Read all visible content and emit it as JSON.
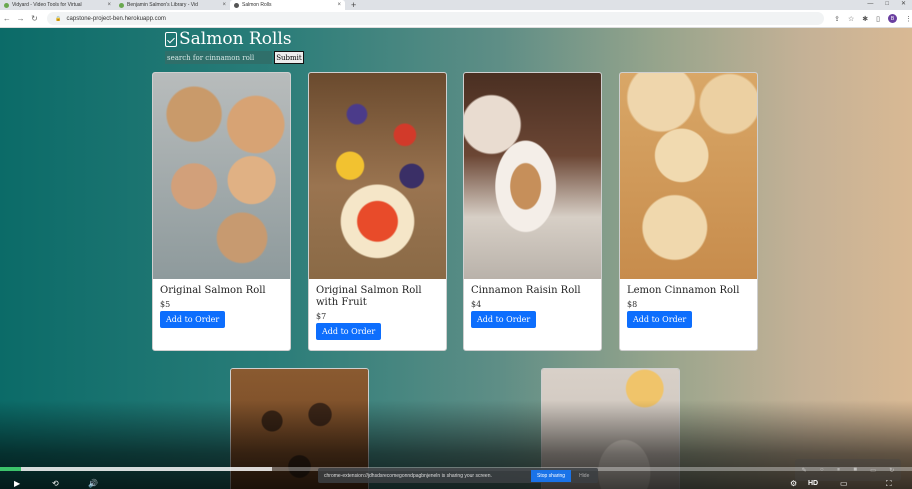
{
  "browser": {
    "tabs": [
      {
        "title": "Vidyard - Video Tools for Virtual",
        "active": false
      },
      {
        "title": "Benjamin Salmon's Library - Vid",
        "active": false
      },
      {
        "title": "Salmon Rolls",
        "active": true
      }
    ],
    "new_tab": "+",
    "url": "capstone-project-ben.herokuapp.com",
    "profile_initial": "B"
  },
  "site": {
    "title": "Salmon Rolls",
    "search_placeholder": "search for cinnamon roll",
    "search_button": "Submit"
  },
  "products": [
    {
      "name": "Original Salmon Roll",
      "price": "$5",
      "button": "Add to Order"
    },
    {
      "name": "Original Salmon Roll with Fruit",
      "price": "$7",
      "button": "Add to Order"
    },
    {
      "name": "Cinnamon Raisin Roll",
      "price": "$4",
      "button": "Add to Order"
    },
    {
      "name": "Lemon Cinnamon Roll",
      "price": "$8",
      "button": "Add to Order"
    }
  ],
  "screen_share": {
    "message": "chrome-extension://jdhsdsrecomegonndpagbnjeneln is sharing your screen.",
    "stop_label": "Stop sharing",
    "hide_label": "Hide"
  },
  "player": {
    "hd_label": "HD",
    "progress": 0.023,
    "buffered": 0.298,
    "accent": "#3cc36b"
  }
}
